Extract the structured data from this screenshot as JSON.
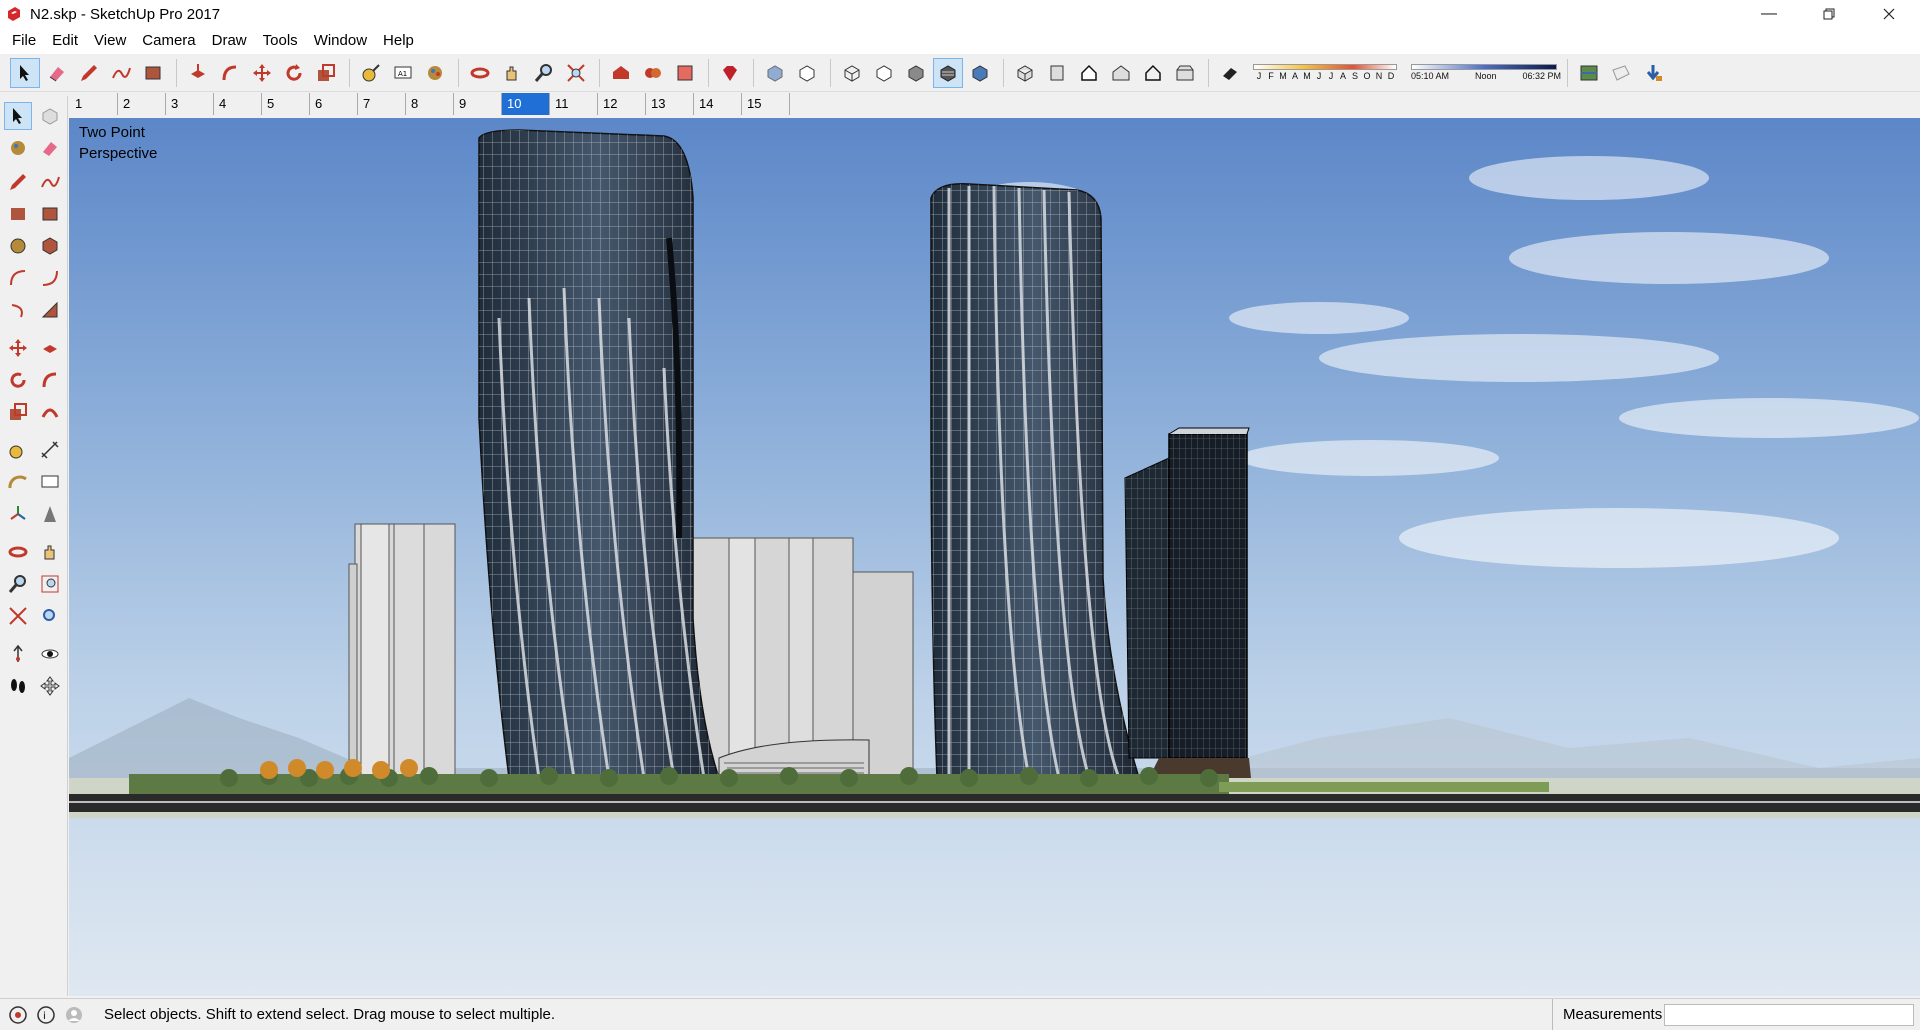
{
  "window": {
    "title": "N2.skp - SketchUp Pro 2017"
  },
  "menu": [
    "File",
    "Edit",
    "View",
    "Camera",
    "Draw",
    "Tools",
    "Window",
    "Help"
  ],
  "shadow": {
    "months": [
      "J",
      "F",
      "M",
      "A",
      "M",
      "J",
      "J",
      "A",
      "S",
      "O",
      "N",
      "D"
    ],
    "time_start": "05:10 AM",
    "time_mid": "Noon",
    "time_end": "06:32 PM"
  },
  "scenes": [
    "1",
    "2",
    "3",
    "4",
    "5",
    "6",
    "7",
    "8",
    "9",
    "10",
    "11",
    "12",
    "13",
    "14",
    "15"
  ],
  "active_scene": "10",
  "viewport": {
    "camera_line1": "Two Point",
    "camera_line2": "Perspective"
  },
  "status": {
    "message": "Select objects. Shift to extend select. Drag mouse to select multiple.",
    "measurements_label": "Measurements",
    "measurements_value": ""
  },
  "icons": {
    "app": "sketchup-icon",
    "toolbar": [
      "select-icon",
      "eraser-icon",
      "pencil-icon",
      "freehand-icon",
      "rectangle-icon",
      "push-pull-icon",
      "follow-me-icon",
      "move-icon",
      "rotate-icon",
      "scale-icon",
      "tape-measure-icon",
      "text-icon",
      "paint-bucket-icon",
      "orbit-icon",
      "pan-icon",
      "zoom-icon",
      "zoom-extents-icon",
      "warehouse-icon",
      "extension-warehouse-icon",
      "layout-icon",
      "ruby-icon",
      "xray-icon",
      "back-edges-icon",
      "wireframe-icon",
      "hidden-line-icon",
      "shaded-icon",
      "shaded-textures-icon",
      "monochrome-icon",
      "iso-icon",
      "top-view-icon",
      "front-view-icon",
      "right-view-icon",
      "back-view-icon",
      "left-view-icon",
      "shadows-toggle-icon",
      "geo-location-icon",
      "photo-texture-icon",
      "export-icon"
    ]
  },
  "colors": {
    "active_scene": "#1f6fd6",
    "sky_top": "#5c87c8",
    "sky_bottom": "#dfe8f1",
    "glass": "#2e3d4f"
  }
}
